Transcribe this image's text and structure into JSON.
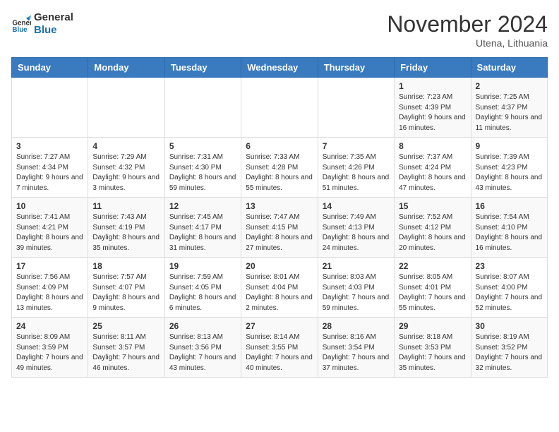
{
  "logo": {
    "text_general": "General",
    "text_blue": "Blue"
  },
  "title": "November 2024",
  "location": "Utena, Lithuania",
  "weekdays": [
    "Sunday",
    "Monday",
    "Tuesday",
    "Wednesday",
    "Thursday",
    "Friday",
    "Saturday"
  ],
  "weeks": [
    [
      {
        "day": "",
        "info": ""
      },
      {
        "day": "",
        "info": ""
      },
      {
        "day": "",
        "info": ""
      },
      {
        "day": "",
        "info": ""
      },
      {
        "day": "",
        "info": ""
      },
      {
        "day": "1",
        "info": "Sunrise: 7:23 AM\nSunset: 4:39 PM\nDaylight: 9 hours and 16 minutes."
      },
      {
        "day": "2",
        "info": "Sunrise: 7:25 AM\nSunset: 4:37 PM\nDaylight: 9 hours and 11 minutes."
      }
    ],
    [
      {
        "day": "3",
        "info": "Sunrise: 7:27 AM\nSunset: 4:34 PM\nDaylight: 9 hours and 7 minutes."
      },
      {
        "day": "4",
        "info": "Sunrise: 7:29 AM\nSunset: 4:32 PM\nDaylight: 9 hours and 3 minutes."
      },
      {
        "day": "5",
        "info": "Sunrise: 7:31 AM\nSunset: 4:30 PM\nDaylight: 8 hours and 59 minutes."
      },
      {
        "day": "6",
        "info": "Sunrise: 7:33 AM\nSunset: 4:28 PM\nDaylight: 8 hours and 55 minutes."
      },
      {
        "day": "7",
        "info": "Sunrise: 7:35 AM\nSunset: 4:26 PM\nDaylight: 8 hours and 51 minutes."
      },
      {
        "day": "8",
        "info": "Sunrise: 7:37 AM\nSunset: 4:24 PM\nDaylight: 8 hours and 47 minutes."
      },
      {
        "day": "9",
        "info": "Sunrise: 7:39 AM\nSunset: 4:23 PM\nDaylight: 8 hours and 43 minutes."
      }
    ],
    [
      {
        "day": "10",
        "info": "Sunrise: 7:41 AM\nSunset: 4:21 PM\nDaylight: 8 hours and 39 minutes."
      },
      {
        "day": "11",
        "info": "Sunrise: 7:43 AM\nSunset: 4:19 PM\nDaylight: 8 hours and 35 minutes."
      },
      {
        "day": "12",
        "info": "Sunrise: 7:45 AM\nSunset: 4:17 PM\nDaylight: 8 hours and 31 minutes."
      },
      {
        "day": "13",
        "info": "Sunrise: 7:47 AM\nSunset: 4:15 PM\nDaylight: 8 hours and 27 minutes."
      },
      {
        "day": "14",
        "info": "Sunrise: 7:49 AM\nSunset: 4:13 PM\nDaylight: 8 hours and 24 minutes."
      },
      {
        "day": "15",
        "info": "Sunrise: 7:52 AM\nSunset: 4:12 PM\nDaylight: 8 hours and 20 minutes."
      },
      {
        "day": "16",
        "info": "Sunrise: 7:54 AM\nSunset: 4:10 PM\nDaylight: 8 hours and 16 minutes."
      }
    ],
    [
      {
        "day": "17",
        "info": "Sunrise: 7:56 AM\nSunset: 4:09 PM\nDaylight: 8 hours and 13 minutes."
      },
      {
        "day": "18",
        "info": "Sunrise: 7:57 AM\nSunset: 4:07 PM\nDaylight: 8 hours and 9 minutes."
      },
      {
        "day": "19",
        "info": "Sunrise: 7:59 AM\nSunset: 4:05 PM\nDaylight: 8 hours and 6 minutes."
      },
      {
        "day": "20",
        "info": "Sunrise: 8:01 AM\nSunset: 4:04 PM\nDaylight: 8 hours and 2 minutes."
      },
      {
        "day": "21",
        "info": "Sunrise: 8:03 AM\nSunset: 4:03 PM\nDaylight: 7 hours and 59 minutes."
      },
      {
        "day": "22",
        "info": "Sunrise: 8:05 AM\nSunset: 4:01 PM\nDaylight: 7 hours and 55 minutes."
      },
      {
        "day": "23",
        "info": "Sunrise: 8:07 AM\nSunset: 4:00 PM\nDaylight: 7 hours and 52 minutes."
      }
    ],
    [
      {
        "day": "24",
        "info": "Sunrise: 8:09 AM\nSunset: 3:59 PM\nDaylight: 7 hours and 49 minutes."
      },
      {
        "day": "25",
        "info": "Sunrise: 8:11 AM\nSunset: 3:57 PM\nDaylight: 7 hours and 46 minutes."
      },
      {
        "day": "26",
        "info": "Sunrise: 8:13 AM\nSunset: 3:56 PM\nDaylight: 7 hours and 43 minutes."
      },
      {
        "day": "27",
        "info": "Sunrise: 8:14 AM\nSunset: 3:55 PM\nDaylight: 7 hours and 40 minutes."
      },
      {
        "day": "28",
        "info": "Sunrise: 8:16 AM\nSunset: 3:54 PM\nDaylight: 7 hours and 37 minutes."
      },
      {
        "day": "29",
        "info": "Sunrise: 8:18 AM\nSunset: 3:53 PM\nDaylight: 7 hours and 35 minutes."
      },
      {
        "day": "30",
        "info": "Sunrise: 8:19 AM\nSunset: 3:52 PM\nDaylight: 7 hours and 32 minutes."
      }
    ]
  ]
}
